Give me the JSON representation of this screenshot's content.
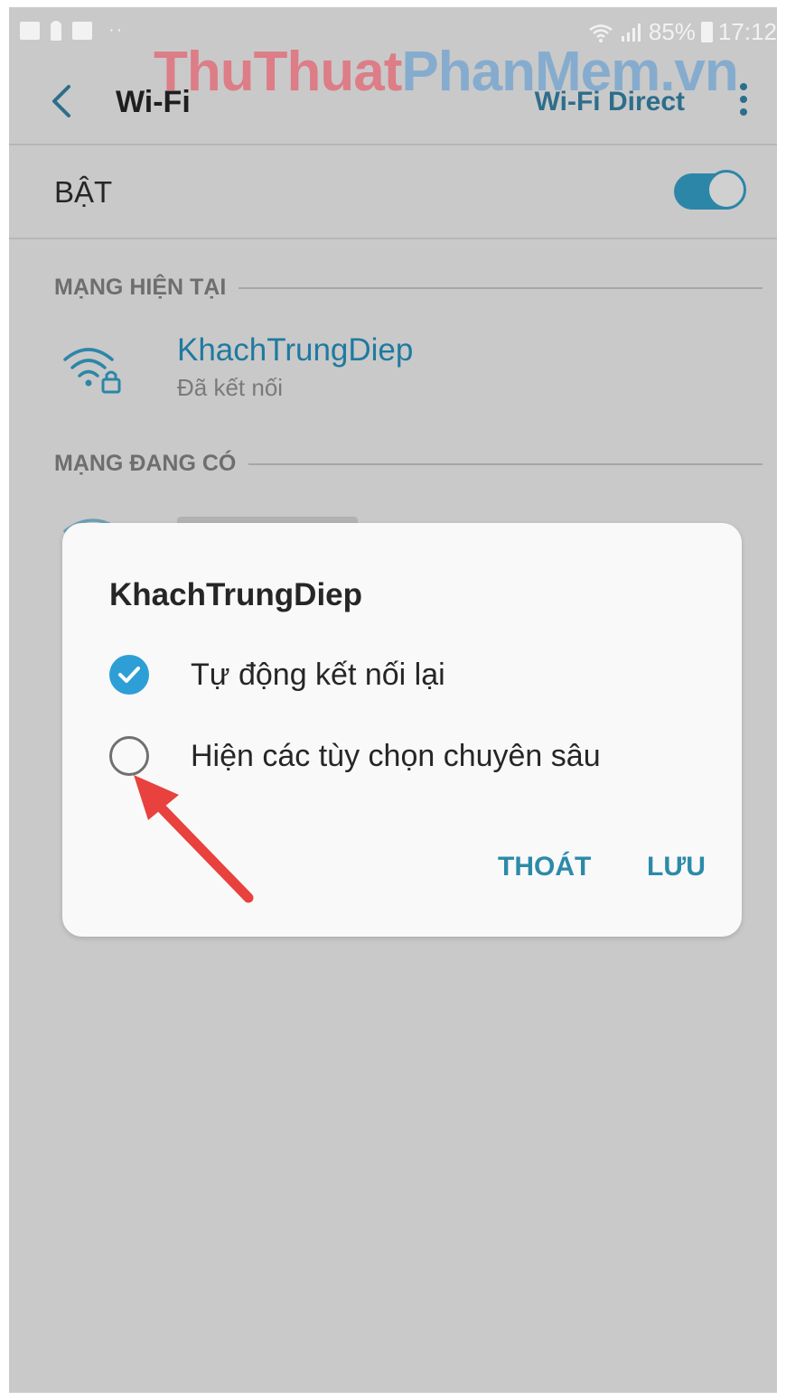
{
  "status_bar": {
    "battery": "85%",
    "time": "17:12",
    "icons": [
      "gallery-icon",
      "key-icon",
      "flipboard-icon",
      "more-dots-icon",
      "wifi-signal-icon",
      "cell-signal-icon",
      "battery-icon"
    ]
  },
  "watermark": {
    "part1": "ThuThuat",
    "part2": "PhanMem.vn"
  },
  "appbar": {
    "title": "Wi-Fi",
    "action": "Wi-Fi Direct"
  },
  "wifi_switch": {
    "label": "BẬT",
    "on": true
  },
  "current_network": {
    "section": "MẠNG HIỆN TẠI",
    "name": "KhachTrungDiep",
    "status": "Đã kết nối"
  },
  "available": {
    "section": "MẠNG ĐANG CÓ"
  },
  "dialog": {
    "title": "KhachTrungDiep",
    "options": [
      {
        "label": "Tự động kết nối lại",
        "checked": true
      },
      {
        "label": "Hiện các tùy chọn chuyên sâu",
        "checked": false
      }
    ],
    "cancel": "THOÁT",
    "save": "LƯU"
  },
  "colors": {
    "accent": "#2c86a8",
    "check": "#2d9fd6",
    "arrow": "#e8413e"
  }
}
